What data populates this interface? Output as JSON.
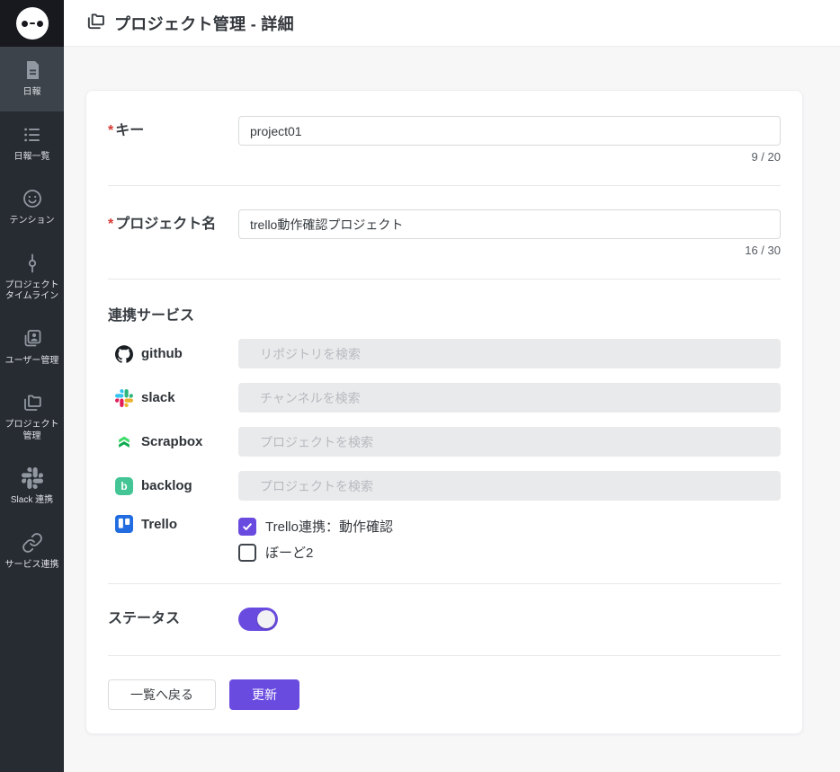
{
  "header": {
    "title": "プロジェクト管理 - 詳細"
  },
  "sidebar": {
    "items": [
      {
        "label": "日報",
        "icon": "daily-report-icon",
        "active": true
      },
      {
        "label": "日報一覧",
        "icon": "daily-report-list-icon",
        "active": false
      },
      {
        "label": "テンション",
        "icon": "tension-smiley-icon",
        "active": false
      },
      {
        "label": "プロジェクトタイムライン",
        "icon": "project-timeline-icon",
        "active": false
      },
      {
        "label": "ユーザー管理",
        "icon": "user-management-icon",
        "active": false
      },
      {
        "label": "プロジェクト管理",
        "icon": "project-management-icon",
        "active": false
      },
      {
        "label": "Slack 連携",
        "icon": "slack-icon",
        "active": false
      },
      {
        "label": "サービス連携",
        "icon": "service-link-icon",
        "active": false
      }
    ]
  },
  "form": {
    "key": {
      "label": "キー",
      "required_mark": "*",
      "value": "project01",
      "counter": "9 / 20"
    },
    "name": {
      "label": "プロジェクト名",
      "required_mark": "*",
      "value": "trello動作確認プロジェクト",
      "counter": "16 / 30"
    },
    "services": {
      "title": "連携サービス",
      "rows": [
        {
          "name": "github",
          "placeholder": "リポジトリを検索",
          "brand_color": "#1b1f23"
        },
        {
          "name": "slack",
          "placeholder": "チャンネルを検索",
          "brand_color": "#e01e5a"
        },
        {
          "name": "Scrapbox",
          "placeholder": "プロジェクトを検索",
          "brand_color": "#0ca94e"
        },
        {
          "name": "backlog",
          "placeholder": "プロジェクトを検索",
          "brand_color": "#44c595"
        },
        {
          "name": "Trello",
          "brand_color": "#216ce0",
          "boards": [
            {
              "label": "Trello連携：動作確認",
              "checked": true
            },
            {
              "label": "ぼーど2",
              "checked": false
            }
          ]
        }
      ]
    },
    "status": {
      "label": "ステータス",
      "enabled": true
    },
    "actions": {
      "back_label": "一覧へ戻る",
      "submit_label": "更新"
    }
  },
  "colors": {
    "accent": "#6a4be0",
    "sidebar_bg": "#272b32",
    "sidebar_active_bg": "#3d434b",
    "card_bg": "#ffffff",
    "page_bg": "#f7f7f8",
    "required_red": "#d63a32"
  }
}
